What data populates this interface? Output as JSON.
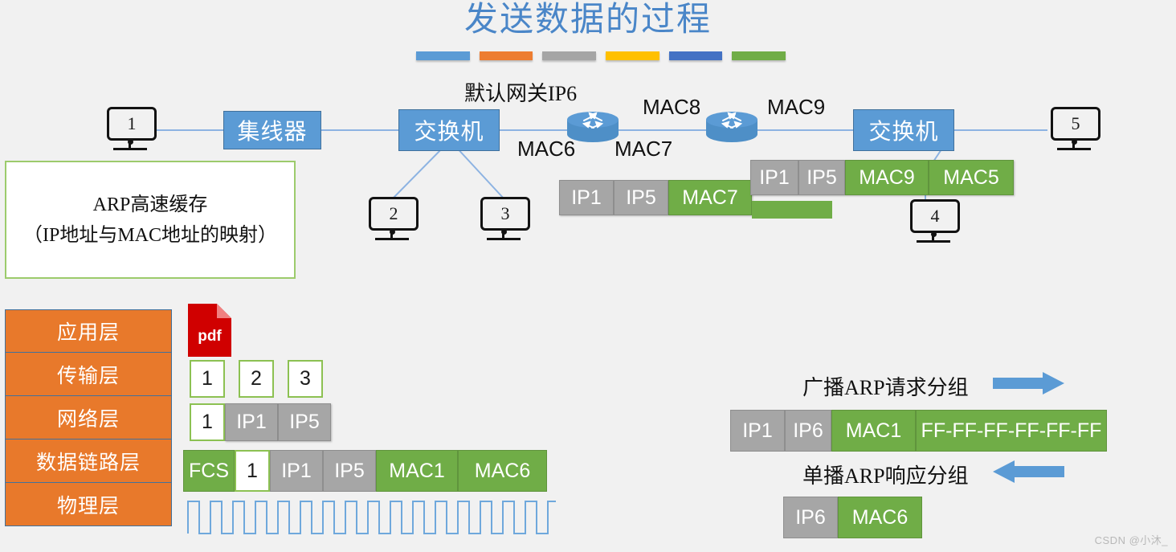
{
  "slide": {
    "title": "发送数据的过程",
    "watermark": "CSDN @小沐_",
    "accent_bar_colors": [
      "#5b9bd5",
      "#ed7d31",
      "#a5a5a5",
      "#ffc000",
      "#4472c4",
      "#70ad47"
    ]
  },
  "topology": {
    "gateway_label": "默认网关IP6",
    "hub_label": "集线器",
    "switch_left_label": "交换机",
    "switch_right_label": "交换机",
    "hosts": [
      {
        "id": "host-1",
        "number": "1"
      },
      {
        "id": "host-2",
        "number": "2"
      },
      {
        "id": "host-3",
        "number": "3"
      },
      {
        "id": "host-4",
        "number": "4"
      },
      {
        "id": "host-5",
        "number": "5"
      }
    ],
    "mac_labels": [
      {
        "name": "mac6",
        "text": "MAC6"
      },
      {
        "name": "mac7",
        "text": "MAC7"
      },
      {
        "name": "mac8",
        "text": "MAC8"
      },
      {
        "name": "mac9",
        "text": "MAC9"
      }
    ]
  },
  "arp_cache": {
    "line1": "ARP高速缓存",
    "line2": "（IP地址与MAC地址的映射）"
  },
  "layers": [
    {
      "name": "application",
      "label": "应用层"
    },
    {
      "name": "transport",
      "label": "传输层"
    },
    {
      "name": "network",
      "label": "网络层"
    },
    {
      "name": "datalink",
      "label": "数据链路层"
    },
    {
      "name": "physical",
      "label": "物理层"
    }
  ],
  "pdf_icon_label": "pdf",
  "encapsulation": {
    "transport_segments": [
      {
        "text": "1",
        "style": "white"
      },
      {
        "text": "2",
        "style": "white"
      },
      {
        "text": "3",
        "style": "white"
      }
    ],
    "network_packet": [
      {
        "text": "1",
        "style": "white"
      },
      {
        "text": "IP1",
        "style": "gray"
      },
      {
        "text": "IP5",
        "style": "gray"
      }
    ],
    "datalink_frame": [
      {
        "text": "FCS",
        "style": "green"
      },
      {
        "text": "1",
        "style": "white"
      },
      {
        "text": "IP1",
        "style": "gray"
      },
      {
        "text": "IP5",
        "style": "gray"
      },
      {
        "text": "MAC1",
        "style": "green"
      },
      {
        "text": "MAC6",
        "style": "green"
      }
    ]
  },
  "inflight_packets": {
    "packet_a": [
      {
        "text": "IP1",
        "style": "gray"
      },
      {
        "text": "IP5",
        "style": "gray"
      },
      {
        "text": "MAC7",
        "style": "green"
      }
    ],
    "packet_b": [
      {
        "text": "IP1",
        "style": "gray"
      },
      {
        "text": "IP5",
        "style": "gray"
      },
      {
        "text": "MAC9",
        "style": "green"
      },
      {
        "text": "MAC5",
        "style": "green"
      }
    ]
  },
  "arp_exchange": {
    "request_label": "广播ARP请求分组",
    "request_packet": [
      {
        "text": "IP1",
        "style": "gray"
      },
      {
        "text": "IP6",
        "style": "gray"
      },
      {
        "text": "MAC1",
        "style": "green"
      },
      {
        "text": "FF-FF-FF-FF-FF-FF",
        "style": "green"
      }
    ],
    "reply_label": "单播ARP响应分组",
    "reply_packet": [
      {
        "text": "IP6",
        "style": "gray"
      },
      {
        "text": "MAC6",
        "style": "green"
      }
    ],
    "arrow_color": "#5b9bd5"
  }
}
